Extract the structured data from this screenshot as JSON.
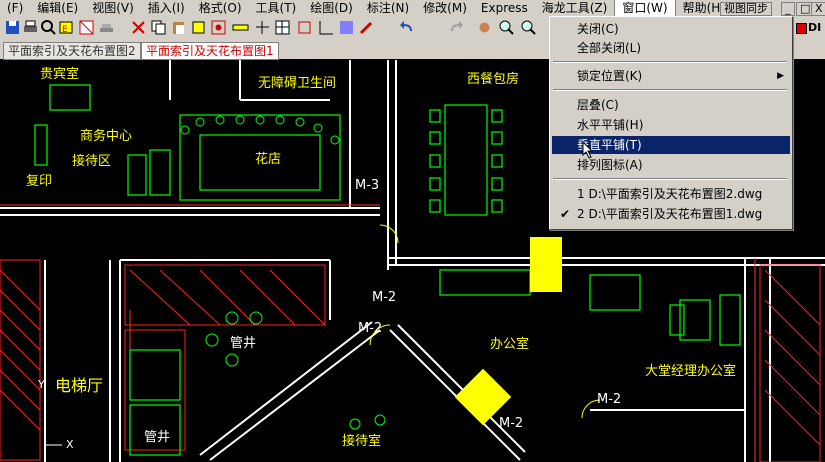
{
  "menubar": [
    "(F)",
    "编辑(E)",
    "视图(V)",
    "插入(I)",
    "格式(O)",
    "工具(T)",
    "绘图(D)",
    "标注(N)",
    "修改(M)",
    "Express",
    "海龙工具(Z)",
    "窗口(W)",
    "帮助(H)"
  ],
  "view_button": "视图同步",
  "window_controls": [
    "_",
    "□",
    "X"
  ],
  "tabs": [
    "平面索引及天花布置图2",
    "平面索引及天花布置图1"
  ],
  "dwg_label": "DI",
  "window_menu": {
    "items": [
      "关闭(C)",
      "全部关闭(L)",
      "锁定位置(K)",
      "层叠(C)",
      "水平平铺(H)",
      "垂直平铺(T)",
      "排列图标(A)",
      "1 D:\\平面索引及天花布置图2.dwg",
      "2 D:\\平面索引及天花布置图1.dwg"
    ],
    "highlighted_index": 5,
    "checked_index": 8
  },
  "cad": {
    "rooms": [
      "贵宾室",
      "商务中心",
      "接待区",
      "复印",
      "花店",
      "无障碍卫生间",
      "西餐包房",
      "电梯厅",
      "管井",
      "管井",
      "办公室",
      "大堂经理办公室",
      "接待室"
    ],
    "doors": [
      "M-3",
      "M-2",
      "M-2",
      "M-2",
      "M-2"
    ],
    "axis_y": "Y",
    "axis_x": "X"
  },
  "colors": {
    "menu_bg": "#d4d0c8",
    "highlight": "#0a246a",
    "cad_bg": "#000000",
    "label": "#ffff00",
    "furniture": "#00ff00",
    "hatch": "#ff2020"
  }
}
